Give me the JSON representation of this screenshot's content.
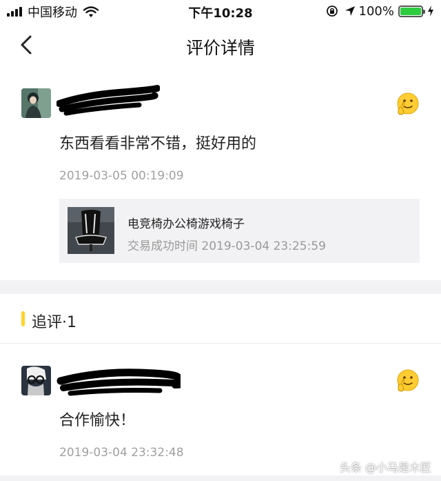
{
  "status_bar": {
    "carrier": "中国移动",
    "time": "下午10:28",
    "battery_percent": "100%",
    "battery_level": 1.0
  },
  "nav": {
    "title": "评价详情",
    "back_icon": "chevron-left-icon"
  },
  "review": {
    "content": "东西看看非常不错，挺好用的",
    "time": "2019-03-05 00:19:09",
    "product": {
      "title": "电竞椅办公椅游戏椅子",
      "trade_time": "交易成功时间 2019-03-04 23:25:59"
    },
    "emoji_icon": "thumbs-up-emoji-icon"
  },
  "followup": {
    "title": "追评·1",
    "content": "合作愉快！",
    "time": "2019-03-04 23:32:48",
    "emoji_icon": "thumbs-up-emoji-icon"
  },
  "watermark": "头条 @小马是木匠",
  "colors": {
    "accent_yellow": "#ffd426",
    "battery_green": "#2ecc40",
    "band_gray": "#f2f2f4"
  }
}
